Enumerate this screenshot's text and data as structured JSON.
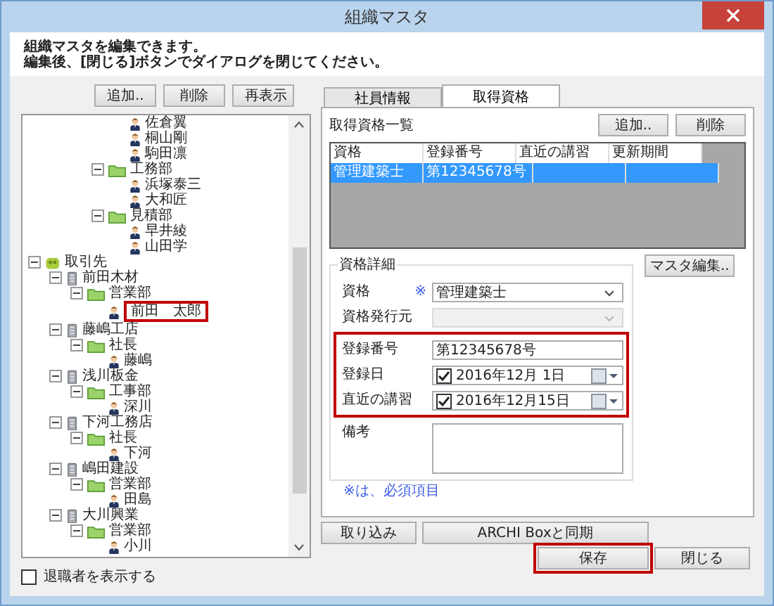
{
  "window": {
    "title": "組織マスタ"
  },
  "instructions": [
    "組織マスタを編集できます。",
    "編集後、[閉じる]ボタンでダイアログを閉じてください。"
  ],
  "tree_buttons": [
    "追加..",
    "削除",
    "再表示"
  ],
  "tree": [
    {
      "kind": "person",
      "label": "佐倉翼"
    },
    {
      "kind": "person",
      "label": "桐山剛"
    },
    {
      "kind": "person",
      "label": "駒田凛"
    },
    {
      "kind": "folder",
      "label": "工務部",
      "expanded": true,
      "children": [
        {
          "kind": "person",
          "label": "浜塚泰三"
        },
        {
          "kind": "person",
          "label": "大和匠"
        }
      ]
    },
    {
      "kind": "folder",
      "label": "見積部",
      "expanded": true,
      "children": [
        {
          "kind": "person",
          "label": "早井綾"
        },
        {
          "kind": "person",
          "label": "山田学"
        }
      ]
    },
    {
      "kind": "group",
      "label": "取引先",
      "expanded": true,
      "children": [
        {
          "kind": "company",
          "label": "前田木材",
          "expanded": true,
          "children": [
            {
              "kind": "folder",
              "label": "営業部",
              "expanded": true,
              "children": [
                {
                  "kind": "person",
                  "label": "前田　太郎"
                }
              ]
            }
          ]
        },
        {
          "kind": "company",
          "label": "藤嶋工店",
          "expanded": true,
          "children": [
            {
              "kind": "folder",
              "label": "社長",
              "expanded": true,
              "children": [
                {
                  "kind": "person",
                  "label": "藤嶋"
                }
              ]
            }
          ]
        },
        {
          "kind": "company",
          "label": "浅川板金",
          "expanded": true,
          "children": [
            {
              "kind": "folder",
              "label": "工事部",
              "expanded": true,
              "children": [
                {
                  "kind": "person",
                  "label": "深川"
                }
              ]
            }
          ]
        },
        {
          "kind": "company",
          "label": "下河工務店",
          "expanded": true,
          "children": [
            {
              "kind": "folder",
              "label": "社長",
              "expanded": true,
              "children": [
                {
                  "kind": "person",
                  "label": "下河"
                }
              ]
            }
          ]
        },
        {
          "kind": "company",
          "label": "嶋田建設",
          "expanded": true,
          "children": [
            {
              "kind": "folder",
              "label": "営業部",
              "expanded": true,
              "children": [
                {
                  "kind": "person",
                  "label": "田島"
                }
              ]
            }
          ]
        },
        {
          "kind": "company",
          "label": "大川興業",
          "expanded": true,
          "children": [
            {
              "kind": "folder",
              "label": "営業部",
              "expanded": true,
              "children": [
                {
                  "kind": "person",
                  "label": "小川"
                }
              ]
            }
          ]
        }
      ]
    }
  ],
  "show_retired": {
    "label": "退職者を表示する",
    "checked": false
  },
  "tabs": [
    {
      "label": "社員情報",
      "selected": false
    },
    {
      "label": "取得資格",
      "selected": true
    }
  ],
  "list": {
    "title": "取得資格一覧",
    "buttons": [
      "追加..",
      "削除"
    ],
    "columns": [
      "資格",
      "登録番号",
      "直近の講習",
      "更新期間"
    ],
    "rows": [
      {
        "cells": [
          "管理建築士",
          "第12345678号"
        ],
        "selected": true
      }
    ]
  },
  "detail": {
    "title": "資格詳細",
    "master_edit_button": "マスタ編集..",
    "fields": [
      {
        "kind": "select",
        "label": "資格",
        "required_mark": "※",
        "value": "管理建築士",
        "disabled": false
      },
      {
        "kind": "select",
        "label": "資格発行元",
        "disabled": true
      },
      {
        "kind": "text",
        "label": "登録番号",
        "value": "第12345678号"
      },
      {
        "kind": "date",
        "label": "登録日",
        "value": "2016年12月 1日",
        "checked": true
      },
      {
        "kind": "date",
        "label": "直近の講習",
        "value": "2016年12月15日",
        "checked": true
      },
      {
        "kind": "textarea",
        "label": "備考"
      }
    ],
    "note": "※は、必須項目"
  },
  "bottom_buttons": [
    "取り込み",
    "ARCHI Boxと同期",
    "保存",
    "閉じる"
  ]
}
